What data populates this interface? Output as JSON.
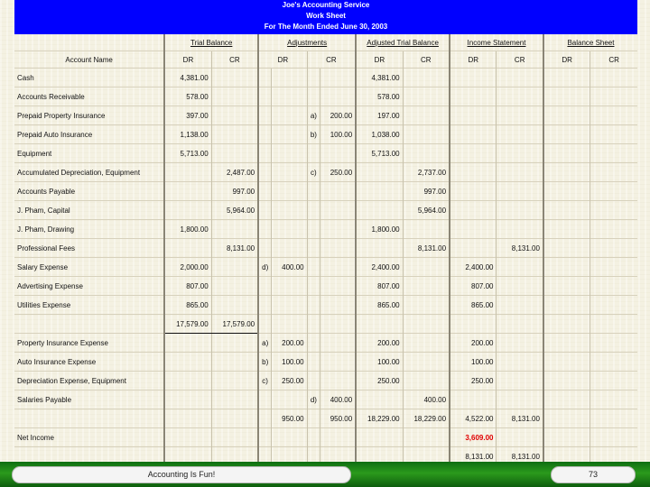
{
  "header": {
    "line1": "Joe's Accounting Service",
    "line2": "Work Sheet",
    "line3": "For The Month Ended June 30, 2003"
  },
  "columns": {
    "account_name": "Account Name",
    "groups": [
      "Trial Balance",
      "Adjustments",
      "Adjusted Trial Balance",
      "Income Statement",
      "Balance Sheet"
    ],
    "dr": "DR",
    "cr": "CR"
  },
  "rows": [
    {
      "name": "Cash",
      "tb_dr": "4,381.00",
      "tb_cr": "",
      "adj_dr_ref": "",
      "adj_dr": "",
      "adj_cr_ref": "",
      "adj_cr": "",
      "atb_dr": "4,381.00",
      "atb_cr": "",
      "is_dr": "",
      "is_cr": "",
      "bs_dr": "",
      "bs_cr": ""
    },
    {
      "name": "Accounts Receivable",
      "tb_dr": "578.00",
      "tb_cr": "",
      "adj_dr_ref": "",
      "adj_dr": "",
      "adj_cr_ref": "",
      "adj_cr": "",
      "atb_dr": "578.00",
      "atb_cr": "",
      "is_dr": "",
      "is_cr": "",
      "bs_dr": "",
      "bs_cr": ""
    },
    {
      "name": "Prepaid Property Insurance",
      "tb_dr": "397.00",
      "tb_cr": "",
      "adj_dr_ref": "",
      "adj_dr": "",
      "adj_cr_ref": "a)",
      "adj_cr": "200.00",
      "atb_dr": "197.00",
      "atb_cr": "",
      "is_dr": "",
      "is_cr": "",
      "bs_dr": "",
      "bs_cr": ""
    },
    {
      "name": "Prepaid Auto Insurance",
      "tb_dr": "1,138.00",
      "tb_cr": "",
      "adj_dr_ref": "",
      "adj_dr": "",
      "adj_cr_ref": "b)",
      "adj_cr": "100.00",
      "atb_dr": "1,038.00",
      "atb_cr": "",
      "is_dr": "",
      "is_cr": "",
      "bs_dr": "",
      "bs_cr": ""
    },
    {
      "name": "Equipment",
      "tb_dr": "5,713.00",
      "tb_cr": "",
      "adj_dr_ref": "",
      "adj_dr": "",
      "adj_cr_ref": "",
      "adj_cr": "",
      "atb_dr": "5,713.00",
      "atb_cr": "",
      "is_dr": "",
      "is_cr": "",
      "bs_dr": "",
      "bs_cr": ""
    },
    {
      "name": "Accumulated Depreciation, Equipment",
      "tb_dr": "",
      "tb_cr": "2,487.00",
      "adj_dr_ref": "",
      "adj_dr": "",
      "adj_cr_ref": "c)",
      "adj_cr": "250.00",
      "atb_dr": "",
      "atb_cr": "2,737.00",
      "is_dr": "",
      "is_cr": "",
      "bs_dr": "",
      "bs_cr": ""
    },
    {
      "name": "Accounts Payable",
      "tb_dr": "",
      "tb_cr": "997.00",
      "adj_dr_ref": "",
      "adj_dr": "",
      "adj_cr_ref": "",
      "adj_cr": "",
      "atb_dr": "",
      "atb_cr": "997.00",
      "is_dr": "",
      "is_cr": "",
      "bs_dr": "",
      "bs_cr": ""
    },
    {
      "name": "J. Pham, Capital",
      "tb_dr": "",
      "tb_cr": "5,964.00",
      "adj_dr_ref": "",
      "adj_dr": "",
      "adj_cr_ref": "",
      "adj_cr": "",
      "atb_dr": "",
      "atb_cr": "5,964.00",
      "is_dr": "",
      "is_cr": "",
      "bs_dr": "",
      "bs_cr": ""
    },
    {
      "name": "J. Pham, Drawing",
      "tb_dr": "1,800.00",
      "tb_cr": "",
      "adj_dr_ref": "",
      "adj_dr": "",
      "adj_cr_ref": "",
      "adj_cr": "",
      "atb_dr": "1,800.00",
      "atb_cr": "",
      "is_dr": "",
      "is_cr": "",
      "bs_dr": "",
      "bs_cr": ""
    },
    {
      "name": "Professional Fees",
      "tb_dr": "",
      "tb_cr": "8,131.00",
      "adj_dr_ref": "",
      "adj_dr": "",
      "adj_cr_ref": "",
      "adj_cr": "",
      "atb_dr": "",
      "atb_cr": "8,131.00",
      "is_dr": "",
      "is_cr": "8,131.00",
      "bs_dr": "",
      "bs_cr": ""
    },
    {
      "name": "Salary Expense",
      "tb_dr": "2,000.00",
      "tb_cr": "",
      "adj_dr_ref": "d)",
      "adj_dr": "400.00",
      "adj_cr_ref": "",
      "adj_cr": "",
      "atb_dr": "2,400.00",
      "atb_cr": "",
      "is_dr": "2,400.00",
      "is_cr": "",
      "bs_dr": "",
      "bs_cr": ""
    },
    {
      "name": "Advertising Expense",
      "tb_dr": "807.00",
      "tb_cr": "",
      "adj_dr_ref": "",
      "adj_dr": "",
      "adj_cr_ref": "",
      "adj_cr": "",
      "atb_dr": "807.00",
      "atb_cr": "",
      "is_dr": "807.00",
      "is_cr": "",
      "bs_dr": "",
      "bs_cr": ""
    },
    {
      "name": "Utilities Expense",
      "tb_dr": "865.00",
      "tb_cr": "",
      "adj_dr_ref": "",
      "adj_dr": "",
      "adj_cr_ref": "",
      "adj_cr": "",
      "atb_dr": "865.00",
      "atb_cr": "",
      "is_dr": "865.00",
      "is_cr": "",
      "bs_dr": "",
      "bs_cr": ""
    },
    {
      "name": "",
      "tb_dr": "17,579.00",
      "tb_cr": "17,579.00",
      "adj_dr_ref": "",
      "adj_dr": "",
      "adj_cr_ref": "",
      "adj_cr": "",
      "atb_dr": "",
      "atb_cr": "",
      "is_dr": "",
      "is_cr": "",
      "bs_dr": "",
      "bs_cr": "",
      "total": true
    },
    {
      "name": "Property Insurance Expense",
      "tb_dr": "",
      "tb_cr": "",
      "adj_dr_ref": "a)",
      "adj_dr": "200.00",
      "adj_cr_ref": "",
      "adj_cr": "",
      "atb_dr": "200.00",
      "atb_cr": "",
      "is_dr": "200.00",
      "is_cr": "",
      "bs_dr": "",
      "bs_cr": ""
    },
    {
      "name": "Auto Insurance Expense",
      "tb_dr": "",
      "tb_cr": "",
      "adj_dr_ref": "b)",
      "adj_dr": "100.00",
      "adj_cr_ref": "",
      "adj_cr": "",
      "atb_dr": "100.00",
      "atb_cr": "",
      "is_dr": "100.00",
      "is_cr": "",
      "bs_dr": "",
      "bs_cr": ""
    },
    {
      "name": "Depreciation Expense, Equipment",
      "tb_dr": "",
      "tb_cr": "",
      "adj_dr_ref": "c)",
      "adj_dr": "250.00",
      "adj_cr_ref": "",
      "adj_cr": "",
      "atb_dr": "250.00",
      "atb_cr": "",
      "is_dr": "250.00",
      "is_cr": "",
      "bs_dr": "",
      "bs_cr": ""
    },
    {
      "name": "Salaries Payable",
      "tb_dr": "",
      "tb_cr": "",
      "adj_dr_ref": "",
      "adj_dr": "",
      "adj_cr_ref": "d)",
      "adj_cr": "400.00",
      "atb_dr": "",
      "atb_cr": "400.00",
      "is_dr": "",
      "is_cr": "",
      "bs_dr": "",
      "bs_cr": ""
    },
    {
      "name": "",
      "tb_dr": "",
      "tb_cr": "",
      "adj_dr_ref": "",
      "adj_dr": "950.00",
      "adj_cr_ref": "",
      "adj_cr": "950.00",
      "atb_dr": "18,229.00",
      "atb_cr": "18,229.00",
      "is_dr": "4,522.00",
      "is_cr": "8,131.00",
      "bs_dr": "",
      "bs_cr": ""
    },
    {
      "name": "Net Income",
      "tb_dr": "",
      "tb_cr": "",
      "adj_dr_ref": "",
      "adj_dr": "",
      "adj_cr_ref": "",
      "adj_cr": "",
      "atb_dr": "",
      "atb_cr": "",
      "is_dr": "3,609.00",
      "is_cr": "",
      "bs_dr": "",
      "bs_cr": "",
      "red_is_dr": true
    },
    {
      "name": "",
      "tb_dr": "",
      "tb_cr": "",
      "adj_dr_ref": "",
      "adj_dr": "",
      "adj_cr_ref": "",
      "adj_cr": "",
      "atb_dr": "",
      "atb_cr": "",
      "is_dr": "8,131.00",
      "is_cr": "8,131.00",
      "bs_dr": "",
      "bs_cr": ""
    }
  ],
  "footer": {
    "caption": "Accounting Is Fun!",
    "page": "73"
  },
  "colors": {
    "header_bg": "#0000ff",
    "footer_bar": "#1f8a18",
    "net_income": "#e00000"
  }
}
